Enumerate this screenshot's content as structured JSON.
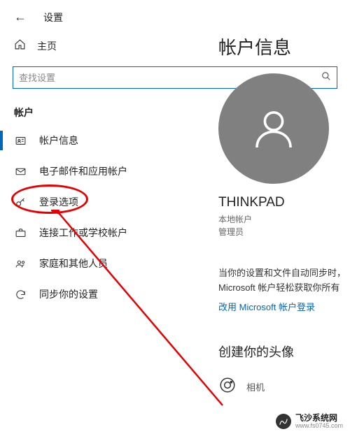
{
  "header": {
    "title": "设置"
  },
  "home": {
    "label": "主页"
  },
  "search": {
    "placeholder": "查找设置"
  },
  "section": {
    "title": "帐户"
  },
  "nav": {
    "items": [
      {
        "label": "帐户信息"
      },
      {
        "label": "电子邮件和应用帐户"
      },
      {
        "label": "登录选项"
      },
      {
        "label": "连接工作或学校帐户"
      },
      {
        "label": "家庭和其他人员"
      },
      {
        "label": "同步你的设置"
      }
    ]
  },
  "content": {
    "title": "帐户信息",
    "username": "THINKPAD",
    "account_type": "本地帐户",
    "account_role": "管理员",
    "sync_line1": "当你的设置和文件自动同步时，",
    "sync_line2": "Microsoft 帐户轻松获取你所有",
    "ms_link": "改用 Microsoft 帐户登录",
    "create_avatar": "创建你的头像",
    "camera_label": "相机"
  },
  "watermark": {
    "title": "飞沙系统网",
    "url": "www.fs0745.com"
  }
}
